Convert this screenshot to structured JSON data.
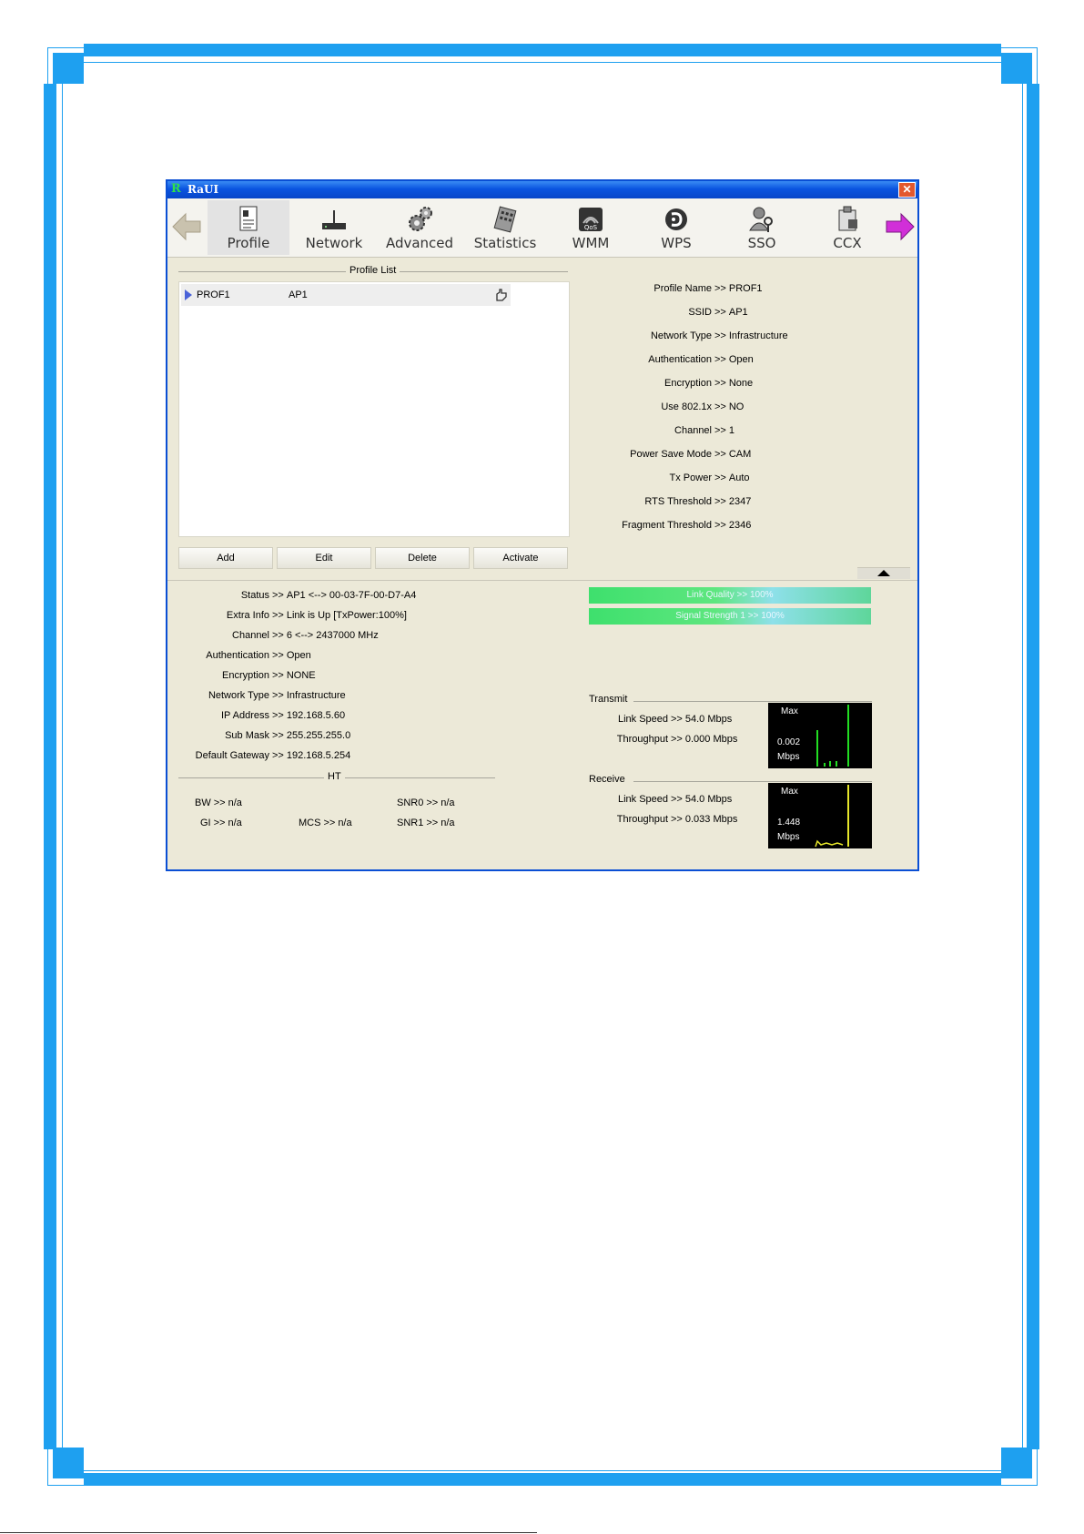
{
  "window": {
    "title": "RaUI",
    "app_icon_letter": "R",
    "close_glyph": "✕"
  },
  "toolbar": {
    "tabs": [
      {
        "label": "Profile",
        "icon": "profile-icon",
        "active": true
      },
      {
        "label": "Network",
        "icon": "network-icon"
      },
      {
        "label": "Advanced",
        "icon": "advanced-gears-icon"
      },
      {
        "label": "Statistics",
        "icon": "statistics-icon"
      },
      {
        "label": "WMM",
        "icon": "wmm-qos-icon"
      },
      {
        "label": "WPS",
        "icon": "wps-icon"
      },
      {
        "label": "SSO",
        "icon": "sso-icon"
      },
      {
        "label": "CCX",
        "icon": "ccx-icon"
      }
    ],
    "icons": {
      "back": "back-arrow-icon",
      "forward": "forward-arrow-icon"
    }
  },
  "profile_list": {
    "title": "Profile List",
    "rows": [
      {
        "name": "PROF1",
        "ssid": "AP1",
        "icon": "hand-pointer-icon"
      }
    ],
    "buttons": {
      "add": "Add",
      "edit": "Edit",
      "delete": "Delete",
      "activate": "Activate"
    }
  },
  "profile_details": [
    {
      "key": "Profile Name",
      "value": "PROF1"
    },
    {
      "key": "SSID",
      "value": "AP1"
    },
    {
      "key": "Network Type",
      "value": "Infrastructure"
    },
    {
      "key": "Authentication",
      "value": "Open"
    },
    {
      "key": "Encryption",
      "value": "None"
    },
    {
      "key": "Use 802.1x",
      "value": "NO"
    },
    {
      "key": "Channel",
      "value": "1"
    },
    {
      "key": "Power Save Mode",
      "value": "CAM"
    },
    {
      "key": "Tx Power",
      "value": "Auto"
    },
    {
      "key": "RTS Threshold",
      "value": "2347"
    },
    {
      "key": "Fragment Threshold",
      "value": "2346"
    }
  ],
  "separator": ">>",
  "status": [
    {
      "key": "Status",
      "value": "AP1 <--> 00-03-7F-00-D7-A4"
    },
    {
      "key": "Extra Info",
      "value": "Link is Up [TxPower:100%]"
    },
    {
      "key": "Channel",
      "value": "6 <--> 2437000 MHz"
    },
    {
      "key": "Authentication",
      "value": "Open"
    },
    {
      "key": "Encryption",
      "value": "NONE"
    },
    {
      "key": "Network Type",
      "value": "Infrastructure"
    },
    {
      "key": "IP Address",
      "value": "192.168.5.60"
    },
    {
      "key": "Sub Mask",
      "value": "255.255.255.0"
    },
    {
      "key": "Default Gateway",
      "value": "192.168.5.254"
    }
  ],
  "ht": {
    "title": "HT",
    "bw": {
      "key": "BW",
      "value": "n/a"
    },
    "gi": {
      "key": "GI",
      "value": "n/a"
    },
    "mcs": {
      "key": "MCS",
      "value": "n/a"
    },
    "snr0": {
      "key": "SNR0",
      "value": "n/a"
    },
    "snr1": {
      "key": "SNR1",
      "value": "n/a"
    }
  },
  "signal": {
    "link_quality": {
      "label": "Link Quality >> 100%",
      "percent": 100
    },
    "signal_strength": {
      "label": "Signal Strength 1 >> 100%",
      "percent": 100
    }
  },
  "transmit": {
    "title": "Transmit",
    "link_speed": {
      "key": "Link Speed",
      "value": "54.0 Mbps"
    },
    "throughput": {
      "key": "Throughput",
      "value": "0.000 Mbps"
    },
    "graph": {
      "max_label": "Max",
      "value": "0.002",
      "unit": "Mbps",
      "color": "#22dd22"
    }
  },
  "receive": {
    "title": "Receive",
    "link_speed": {
      "key": "Link Speed",
      "value": "54.0 Mbps"
    },
    "throughput": {
      "key": "Throughput",
      "value": "0.033 Mbps"
    },
    "graph": {
      "max_label": "Max",
      "value": "1.448",
      "unit": "Mbps",
      "color": "#e6e62a"
    }
  },
  "colors": {
    "frame_blue": "#1ea0f0",
    "titlebar_blue": "#0a54e0",
    "dialog_bg": "#ece9d8"
  }
}
